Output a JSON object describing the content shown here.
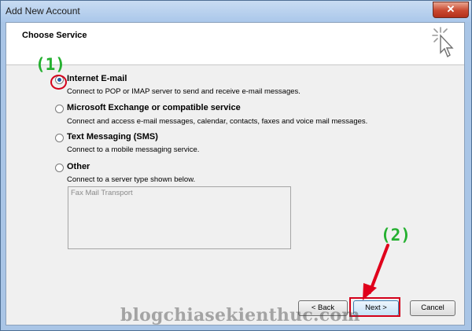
{
  "window": {
    "title": "Add New Account",
    "close_label": "✕"
  },
  "header": {
    "title": "Choose Service"
  },
  "annotations": {
    "step1": "(1)",
    "step2": "(2)",
    "accent_color": "#d4001a",
    "label_color": "#25b030"
  },
  "options": [
    {
      "label": "Internet E-mail",
      "description": "Connect to POP or IMAP server to send and receive e-mail messages.",
      "selected": true
    },
    {
      "label": "Microsoft Exchange or compatible service",
      "description": "Connect and access e-mail messages, calendar, contacts, faxes and voice mail messages.",
      "selected": false
    },
    {
      "label": "Text Messaging (SMS)",
      "description": "Connect to a mobile messaging service.",
      "selected": false
    },
    {
      "label": "Other",
      "description": "Connect to a server type shown below.",
      "selected": false
    }
  ],
  "other_list": {
    "items": [
      "Fax Mail Transport"
    ]
  },
  "buttons": {
    "back": "< Back",
    "next": "Next >",
    "cancel": "Cancel"
  },
  "watermark": "blogchiasekienthuc.com"
}
